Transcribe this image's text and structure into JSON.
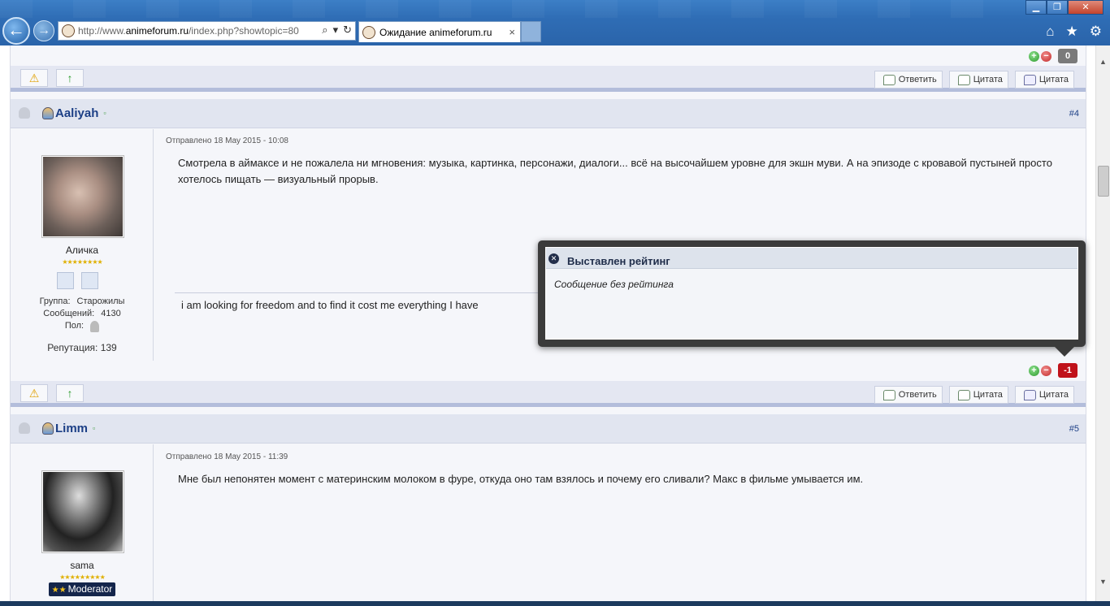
{
  "browser": {
    "url_prefix": "http://www.",
    "url_domain": "animeforum.ru",
    "url_rest": "/index.php?showtopic=80",
    "tab_title": "Ожидание animeforum.ru",
    "tab_close": "×"
  },
  "labels": {
    "reply": "Ответить",
    "quote": "Цитата",
    "quote2": "Цитата"
  },
  "rep_top": {
    "value": "0"
  },
  "posts": [
    {
      "username": "Aaliyah",
      "number": "#4",
      "posted": "Отправлено 18 May 2015 - 10:08",
      "display_name": "Аличка",
      "group_label": "Группа:",
      "group": "Старожилы",
      "messages_label": "Сообщений:",
      "messages": "4130",
      "gender_label": "Пол:",
      "reputation": "Репутация: 139",
      "body": "Смотрела в аймаксе и не пожалела ни мгновения: музыка, картинка, персонажи, диалоги... всё на высочайшем уровне для экшн муви. А на эпизоде с кровавой пустыней просто хотелось пищать — визуальный прорыв.",
      "signature": "i am looking for freedom and to find it cost me everything I have",
      "rep": "-1"
    },
    {
      "username": "Limm",
      "number": "#5",
      "posted": "Отправлено 18 May 2015 - 11:39",
      "display_name": "sama",
      "badge": "Moderator",
      "body": "Мне был непонятен момент с материнским молоком в фуре, откуда оно там взялось и почему его сливали? Макс в фильме умывается им."
    }
  ],
  "popup": {
    "title": "Выставлен рейтинг",
    "message": "Сообщение без рейтинга"
  },
  "colors": {
    "rep_zero": "#7a7a7a",
    "rep_negative": "#c0121a",
    "link": "#1c3f86"
  }
}
